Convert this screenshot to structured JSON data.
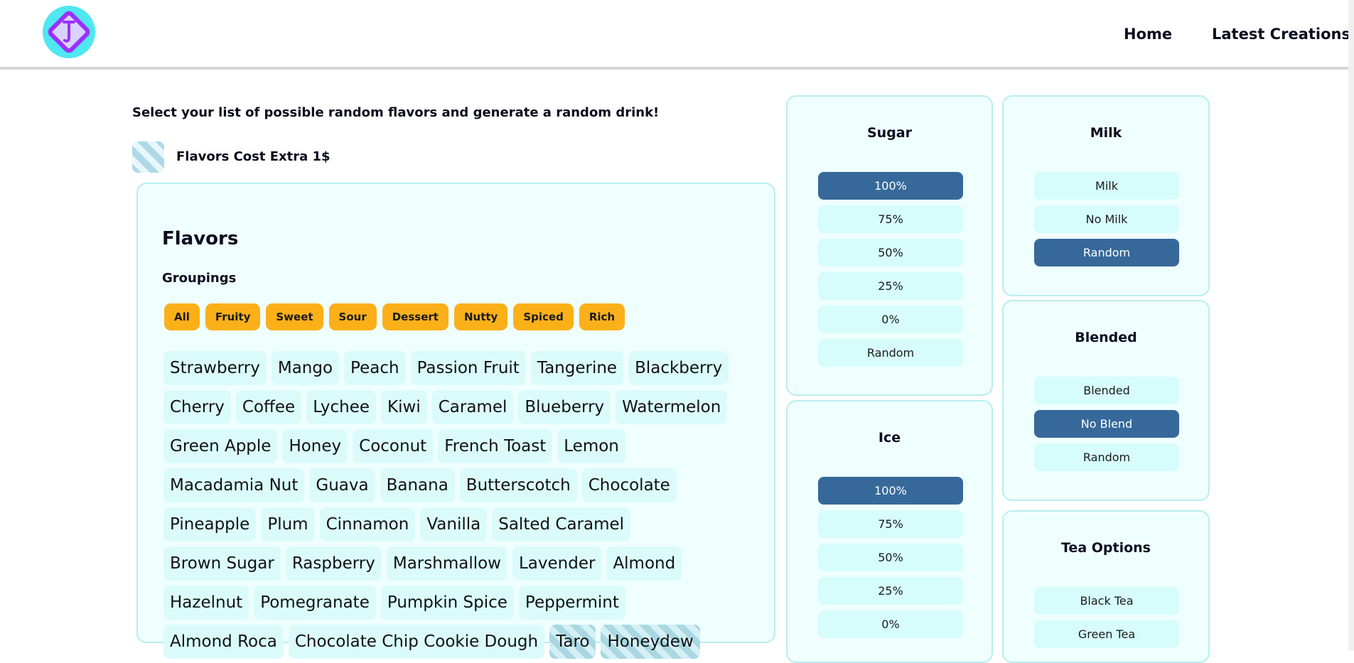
{
  "header": {
    "logo": "drink-logo-icon",
    "nav": {
      "home": "Home",
      "latest": "Latest Creations"
    }
  },
  "intro": "Select your list of possible random flavors and generate a random drink!",
  "legend": {
    "text": "Flavors Cost Extra 1$"
  },
  "flavors_panel": {
    "title": "Flavors",
    "groupings_title": "Groupings",
    "groupings": [
      "All",
      "Fruity",
      "Sweet",
      "Sour",
      "Dessert",
      "Nutty",
      "Spiced",
      "Rich"
    ],
    "flavors": [
      "Strawberry",
      "Mango",
      "Peach",
      "Passion Fruit",
      "Tangerine",
      "Blackberry",
      "Cherry",
      "Coffee",
      "Lychee",
      "Kiwi",
      "Caramel",
      "Blueberry",
      "Watermelon",
      "Green Apple",
      "Honey",
      "Coconut",
      "French Toast",
      "Lemon",
      "Macadamia Nut",
      "Guava",
      "Banana",
      "Butterscotch",
      "Chocolate",
      "Pineapple",
      "Plum",
      "Cinnamon",
      "Vanilla",
      "Salted Caramel",
      "Brown Sugar",
      "Raspberry",
      "Marshmallow",
      "Lavender",
      "Almond",
      "Hazelnut",
      "Pomegranate",
      "Pumpkin Spice",
      "Peppermint",
      "Almond Roca",
      "Chocolate Chip Cookie Dough",
      "Taro",
      "Honeydew"
    ],
    "extra_cost_flavors": [
      "Taro",
      "Honeydew"
    ]
  },
  "sugar": {
    "title": "Sugar",
    "options": [
      "100%",
      "75%",
      "50%",
      "25%",
      "0%",
      "Random"
    ],
    "selected": "100%"
  },
  "ice": {
    "title": "Ice",
    "options": [
      "100%",
      "75%",
      "50%",
      "25%",
      "0%"
    ],
    "selected": "100%"
  },
  "milk": {
    "title": "Milk",
    "options": [
      "Milk",
      "No Milk",
      "Random"
    ],
    "selected": "Random"
  },
  "blended": {
    "title": "Blended",
    "options": [
      "Blended",
      "No Blend",
      "Random"
    ],
    "selected": "No Blend"
  },
  "tea": {
    "title": "Tea Options",
    "options": [
      "Black Tea",
      "Green Tea"
    ]
  },
  "colors": {
    "accent_orange": "#fbb01a",
    "selected_blue": "#36699a",
    "panel_bg": "#effffe",
    "option_bg": "#d6fcfc",
    "logo_cyan": "#4fe7f0",
    "logo_purple": "#9b30ff"
  }
}
